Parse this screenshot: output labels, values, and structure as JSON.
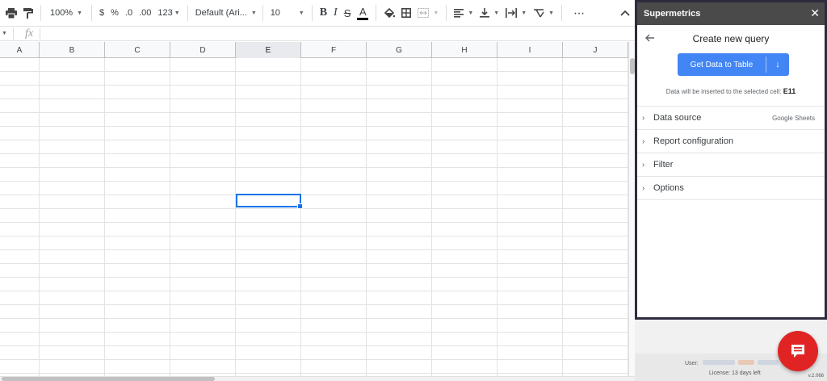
{
  "toolbar": {
    "zoom": "100%",
    "currency": "$",
    "percent": "%",
    "decrease_decimals": ".0",
    "increase_decimals": ".00",
    "more_formats": "123",
    "font": "Default (Ari...",
    "font_size": "10",
    "bold": "B",
    "italic": "I",
    "strikethrough": "S",
    "text_color": "A",
    "more": "⋯"
  },
  "formula_bar": {
    "fx": "fx"
  },
  "columns": [
    "A",
    "B",
    "C",
    "D",
    "E",
    "F",
    "G",
    "H",
    "I",
    "J"
  ],
  "selected_column": "E",
  "sidebar": {
    "title": "Supermetrics",
    "close": "✕",
    "query_title": "Create new query",
    "button_label": "Get Data to Table",
    "button_arrow": "↓",
    "info_prefix": "Data will be inserted to the selected cell:",
    "info_cell": "E11",
    "sections": [
      {
        "label": "Data source",
        "value": "Google Sheets"
      },
      {
        "label": "Report configuration",
        "value": ""
      },
      {
        "label": "Filter",
        "value": ""
      },
      {
        "label": "Options",
        "value": ""
      }
    ],
    "footer": {
      "user_label": "User:",
      "license": "License: 13 days left",
      "version": "v.2.066"
    }
  },
  "colors": {
    "accent": "#4285f4",
    "panel_border": "#2f2b3d",
    "panel_header": "#4a4a4a",
    "chat": "#e02424",
    "selection": "#1a73e8"
  }
}
